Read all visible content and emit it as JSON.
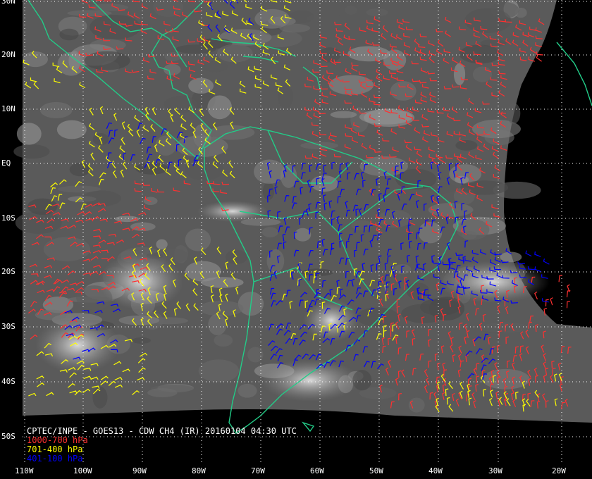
{
  "title": "CPTEC/INPE - GOES13 - CDW CH4 (IR) 20160104 04:30 UTC",
  "legend": [
    {
      "label": "1000-700 hPa",
      "color": "#ff3030"
    },
    {
      "label": "701-400 hPa",
      "color": "#ffff00"
    },
    {
      "label": "401-100 hPa",
      "color": "#0000ff"
    }
  ],
  "lat_labels": [
    "30N",
    "20N",
    "10N",
    "EQ",
    "10S",
    "20S",
    "30S",
    "40S",
    "50S"
  ],
  "lon_labels": [
    "110W",
    "100W",
    "90W",
    "80W",
    "70W",
    "60W",
    "50W",
    "40W",
    "30W",
    "20W"
  ],
  "colors": {
    "coast": "#22cc88",
    "grid": "#ffffff",
    "background": "#000000"
  }
}
